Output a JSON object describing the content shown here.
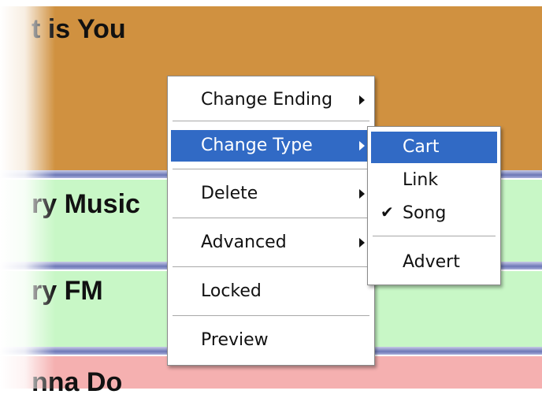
{
  "rows": [
    {
      "title": "t is You",
      "color": "#d09140"
    },
    {
      "title": "ry Music",
      "color": "#c8f7c6"
    },
    {
      "title": "ry FM",
      "color": "#c8f7c6"
    },
    {
      "title": "nna Do",
      "color": "#f5b0b0"
    }
  ],
  "context_menu": {
    "items": [
      {
        "label": "Change Ending",
        "has_submenu": true
      },
      {
        "label": "Change Type",
        "has_submenu": true,
        "highlighted": true
      },
      {
        "label": "Delete",
        "has_submenu": true
      },
      {
        "label": "Advanced",
        "has_submenu": true
      },
      {
        "label": "Locked",
        "has_submenu": false
      },
      {
        "label": "Preview",
        "has_submenu": false
      }
    ]
  },
  "type_submenu": {
    "items": [
      {
        "label": "Cart",
        "highlighted": true
      },
      {
        "label": "Link"
      },
      {
        "label": "Song",
        "checked": true
      },
      {
        "label": "Advert"
      }
    ]
  },
  "colors": {
    "highlight": "#316ac5",
    "separator": "#6c77b6"
  }
}
